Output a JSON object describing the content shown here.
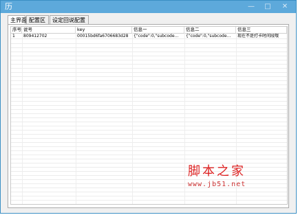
{
  "window": {
    "title": "",
    "icon_glyph": "历",
    "buttons": {
      "minimize": "—",
      "maximize": "□",
      "close": "✕"
    }
  },
  "tabs": [
    {
      "label": "主界面"
    },
    {
      "label": "配置区"
    },
    {
      "label": "设定回说配置"
    }
  ],
  "table": {
    "columns": [
      "序号",
      "说号",
      "key",
      "信息一",
      "信息二",
      "信息三"
    ],
    "rows": [
      [
        "1",
        "809412702",
        "00015bd6fa6706683d28",
        "{\"code\":0,\"subcode...",
        "{\"code\":0,\"subcode...",
        "现在不是打卡时间段哦"
      ]
    ]
  },
  "watermark": {
    "text": "脚本之家",
    "url": "www.jb51.net"
  },
  "colors": {
    "titlebar": "#5da9db",
    "watermark": "#dd2222"
  }
}
